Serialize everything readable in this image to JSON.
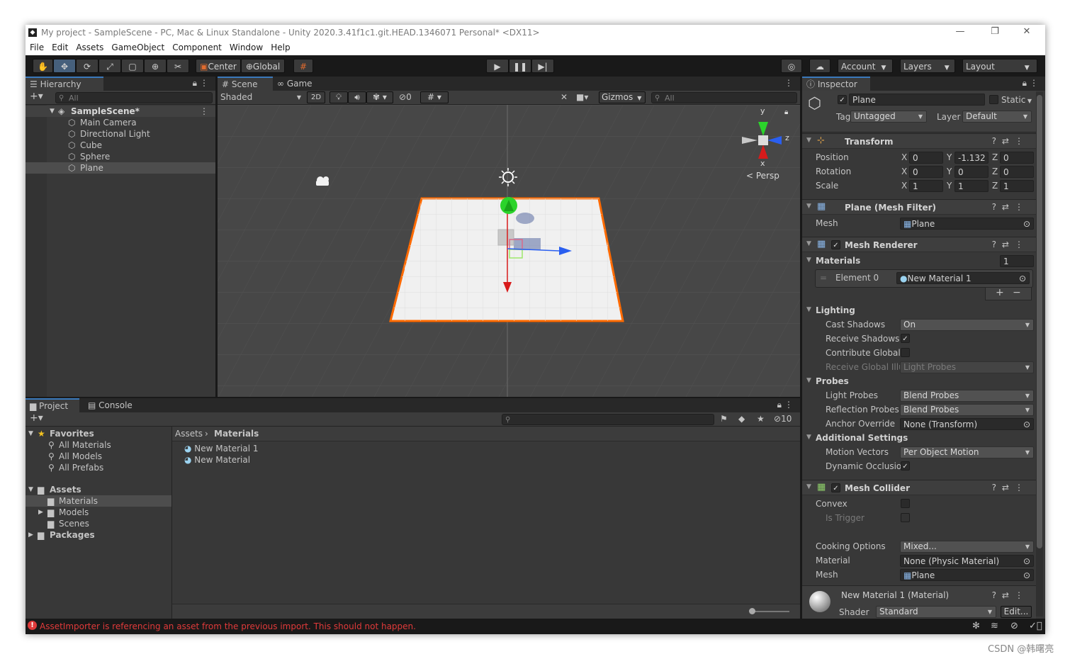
{
  "window": {
    "title": "My project - SampleScene - PC, Mac & Linux Standalone - Unity 2020.3.41f1c1.git.HEAD.1346071 Personal* <DX11>",
    "controls": [
      "—",
      "❐",
      "✕"
    ]
  },
  "menu": [
    "File",
    "Edit",
    "Assets",
    "GameObject",
    "Component",
    "Window",
    "Help"
  ],
  "toolbar": {
    "center_label": "Center",
    "global_label": "Global",
    "account_label": "Account",
    "layers_label": "Layers",
    "layout_label": "Layout"
  },
  "hierarchy": {
    "tab": "Hierarchy",
    "search_placeholder": "All",
    "scene": "SampleScene*",
    "items": [
      "Main Camera",
      "Directional Light",
      "Cube",
      "Sphere",
      "Plane"
    ],
    "selected": "Plane"
  },
  "scene": {
    "tabs": [
      "Scene",
      "Game"
    ],
    "shading": "Shaded",
    "mode_2d": "2D",
    "hidden_count": "0",
    "gizmos_label": "Gizmos",
    "search_placeholder": "All",
    "gizmo_axes": {
      "y": "y",
      "z": "z",
      "x": "x"
    },
    "persp_label": "< Persp"
  },
  "project": {
    "tabs": [
      "Project",
      "Console"
    ],
    "favorites_label": "Favorites",
    "favorites": [
      "All Materials",
      "All Models",
      "All Prefabs"
    ],
    "assets_label": "Assets",
    "assets_children": [
      "Materials",
      "Models",
      "Scenes"
    ],
    "packages_label": "Packages",
    "breadcrumb": [
      "Assets",
      "Materials"
    ],
    "files": [
      "New Material 1",
      "New Material"
    ],
    "hidden_packages": "10"
  },
  "inspector": {
    "tab": "Inspector",
    "object_name": "Plane",
    "static_label": "Static",
    "tag_label": "Tag",
    "tag_value": "Untagged",
    "layer_label": "Layer",
    "layer_value": "Default",
    "transform": {
      "title": "Transform",
      "rows": [
        {
          "label": "Position",
          "x": "0",
          "y": "-1.132",
          "z": "0"
        },
        {
          "label": "Rotation",
          "x": "0",
          "y": "0",
          "z": "0"
        },
        {
          "label": "Scale",
          "x": "1",
          "y": "1",
          "z": "1"
        }
      ],
      "axis_labels": [
        "X",
        "Y",
        "Z"
      ]
    },
    "mesh_filter": {
      "title": "Plane (Mesh Filter)",
      "mesh_label": "Mesh",
      "mesh_value": "Plane"
    },
    "mesh_renderer": {
      "title": "Mesh Renderer",
      "materials_label": "Materials",
      "materials_count": "1",
      "element_label": "Element 0",
      "element_value": "New Material 1",
      "plus": "+",
      "minus": "−",
      "lighting_label": "Lighting",
      "cast_shadows_label": "Cast Shadows",
      "cast_shadows_value": "On",
      "receive_shadows_label": "Receive Shadows",
      "contribute_gi_label": "Contribute Global I",
      "receive_gi_label": "Receive Global Illu",
      "receive_gi_value": "Light Probes",
      "probes_label": "Probes",
      "light_probes_label": "Light Probes",
      "light_probes_value": "Blend Probes",
      "reflection_probes_label": "Reflection Probes",
      "reflection_probes_value": "Blend Probes",
      "anchor_override_label": "Anchor Override",
      "anchor_override_value": "None (Transform)",
      "additional_label": "Additional Settings",
      "motion_vectors_label": "Motion Vectors",
      "motion_vectors_value": "Per Object Motion",
      "dynamic_occlusion_label": "Dynamic Occlusio"
    },
    "mesh_collider": {
      "title": "Mesh Collider",
      "convex_label": "Convex",
      "is_trigger_label": "Is Trigger",
      "cooking_label": "Cooking Options",
      "cooking_value": "Mixed...",
      "material_label": "Material",
      "material_value": "None (Physic Material)",
      "mesh_label": "Mesh",
      "mesh_value": "Plane"
    },
    "material": {
      "title": "New Material 1 (Material)",
      "shader_label": "Shader",
      "shader_value": "Standard",
      "edit_label": "Edit..."
    }
  },
  "status": {
    "error": "AssetImporter is referencing an asset from the previous import. This should not happen.",
    "error_color": "#e03a3a"
  },
  "watermark": "CSDN @韩曙亮",
  "colors": {
    "selection_outline": "#ff6a00",
    "accent": "#3a79bb"
  }
}
